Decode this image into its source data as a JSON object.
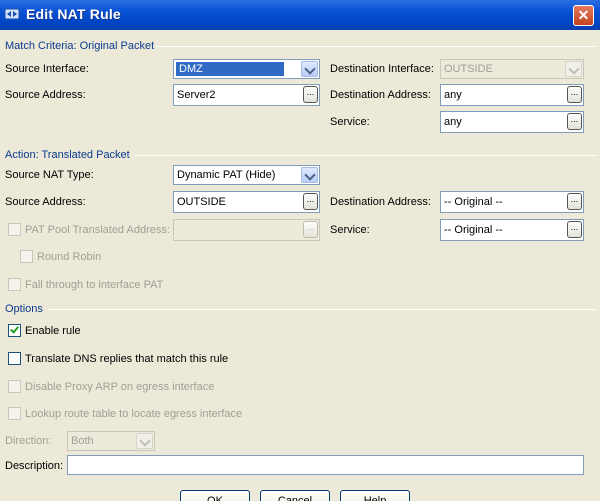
{
  "window": {
    "title": "Edit NAT Rule",
    "close_glyph": "✕"
  },
  "match": {
    "section_title": "Match Criteria: Original Packet",
    "source_interface_label": "Source Interface:",
    "source_interface_value": "DMZ",
    "destination_interface_label": "Destination Interface:",
    "destination_interface_value": "OUTSIDE",
    "source_address_label": "Source Address:",
    "source_address_value": "Server2",
    "destination_address_label": "Destination Address:",
    "destination_address_value": "any",
    "service_label": "Service:",
    "service_value": "any"
  },
  "action": {
    "section_title": "Action: Translated Packet",
    "source_nat_type_label": "Source NAT Type:",
    "source_nat_type_value": "Dynamic PAT (Hide)",
    "source_address_label": "Source Address:",
    "source_address_value": "OUTSIDE",
    "destination_address_label": "Destination Address:",
    "destination_address_value": "-- Original --",
    "pat_pool_label": "PAT Pool Translated Address:",
    "pat_pool_value": "",
    "service_label": "Service:",
    "service_value": "-- Original --",
    "round_robin_label": "Round Robin",
    "fall_through_label": "Fall through to interface PAT"
  },
  "options": {
    "section_title": "Options",
    "enable_rule_label": "Enable rule",
    "enable_rule_checked": true,
    "translate_dns_label": "Translate DNS replies that match this rule",
    "disable_proxy_arp_label": "Disable Proxy ARP on egress interface",
    "lookup_route_label": "Lookup route table to locate egress interface",
    "direction_label": "Direction:",
    "direction_value": "Both",
    "description_label": "Description:",
    "description_value": ""
  },
  "buttons": {
    "ok": "OK",
    "cancel": "Cancel",
    "help": "Help"
  },
  "browse_glyph": "..."
}
